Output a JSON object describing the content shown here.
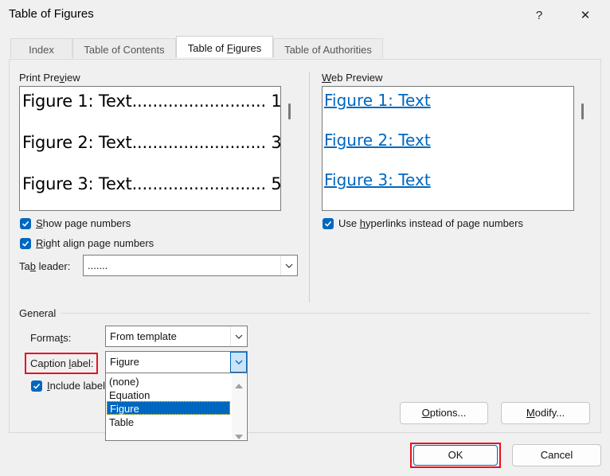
{
  "window": {
    "title": "Table of Figures",
    "help": "?",
    "close": "✕"
  },
  "tabs": [
    {
      "label": "Index"
    },
    {
      "label": "Table of Contents"
    },
    {
      "label": "Table of Figures"
    },
    {
      "label": "Table of Authorities"
    }
  ],
  "print_preview": {
    "heading": "Print Preview",
    "lines": [
      "Figure 1: Text.......................... 1",
      "Figure 2: Text.......................... 3",
      "Figure 3: Text.......................... 5"
    ]
  },
  "web_preview": {
    "heading": "Web Preview",
    "lines": [
      "Figure 1: Text",
      "Figure 2: Text",
      "Figure 3: Text"
    ]
  },
  "options": {
    "show_page_numbers": {
      "label": "Show page numbers",
      "checked": true
    },
    "right_align": {
      "label": "Right align page numbers",
      "checked": true
    },
    "use_hyperlinks": {
      "label": "Use hyperlinks instead of page numbers",
      "checked": true
    },
    "tab_leader": {
      "label": "Tab leader:",
      "value": "......."
    }
  },
  "general": {
    "heading": "General",
    "formats": {
      "label": "Formats:",
      "value": "From template"
    },
    "caption_label": {
      "label": "Caption label:",
      "value": "Figure",
      "options": [
        "(none)",
        "Equation",
        "Figure",
        "Table"
      ],
      "selected_index": 2
    },
    "include_label": {
      "label": "Include label",
      "checked": true
    }
  },
  "buttons": {
    "options": "Options...",
    "modify": "Modify...",
    "ok": "OK",
    "cancel": "Cancel"
  },
  "colors": {
    "accent": "#0067c0",
    "highlight_border": "#e81123"
  }
}
